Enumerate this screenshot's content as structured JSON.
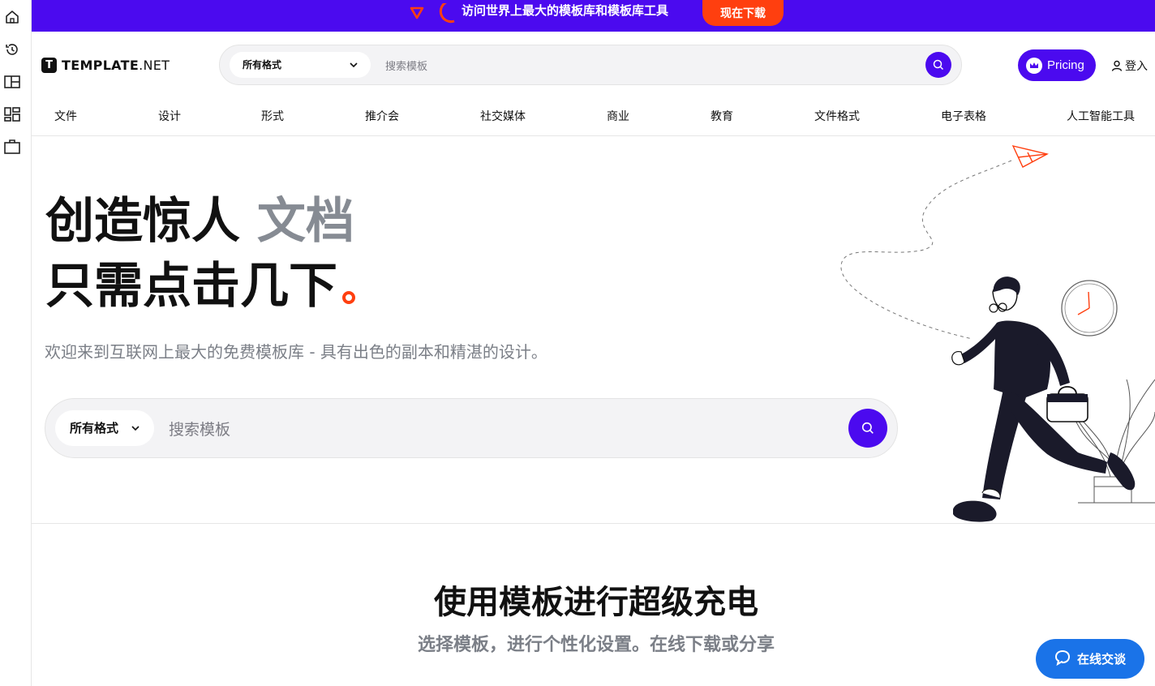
{
  "sidebar": {
    "icons": [
      "home-icon",
      "history-icon",
      "layout-icon",
      "templates-icon",
      "briefcase-icon"
    ]
  },
  "banner": {
    "text": "访问世界上最大的模板库和模板库工具",
    "cta": "现在下载"
  },
  "header": {
    "logo_main": "TEMPLATE",
    "logo_suffix": ".NET",
    "search": {
      "format_label": "所有格式",
      "placeholder": "搜索模板"
    },
    "pricing_label": "Pricing",
    "login_label": "登入"
  },
  "nav": {
    "items": [
      "文件",
      "设计",
      "形式",
      "推介会",
      "社交媒体",
      "商业",
      "教育",
      "文件格式",
      "电子表格",
      "人工智能工具"
    ]
  },
  "hero": {
    "line1": "创造惊人",
    "line1_highlight": "文档",
    "line2": "只需点击几下",
    "subtitle": "欢迎来到互联网上最大的免费模板库 - 具有出色的副本和精湛的设计。",
    "search": {
      "format_label": "所有格式",
      "placeholder": "搜索模板"
    }
  },
  "section": {
    "title": "使用模板进行超级充电",
    "subtitle": "选择模板，进行个性化设置。在线下载或分享"
  },
  "chat": {
    "label": "在线交谈"
  },
  "colors": {
    "brand": "#4b0aef",
    "accent": "#ff3f0f",
    "chat": "#1a73e8"
  }
}
